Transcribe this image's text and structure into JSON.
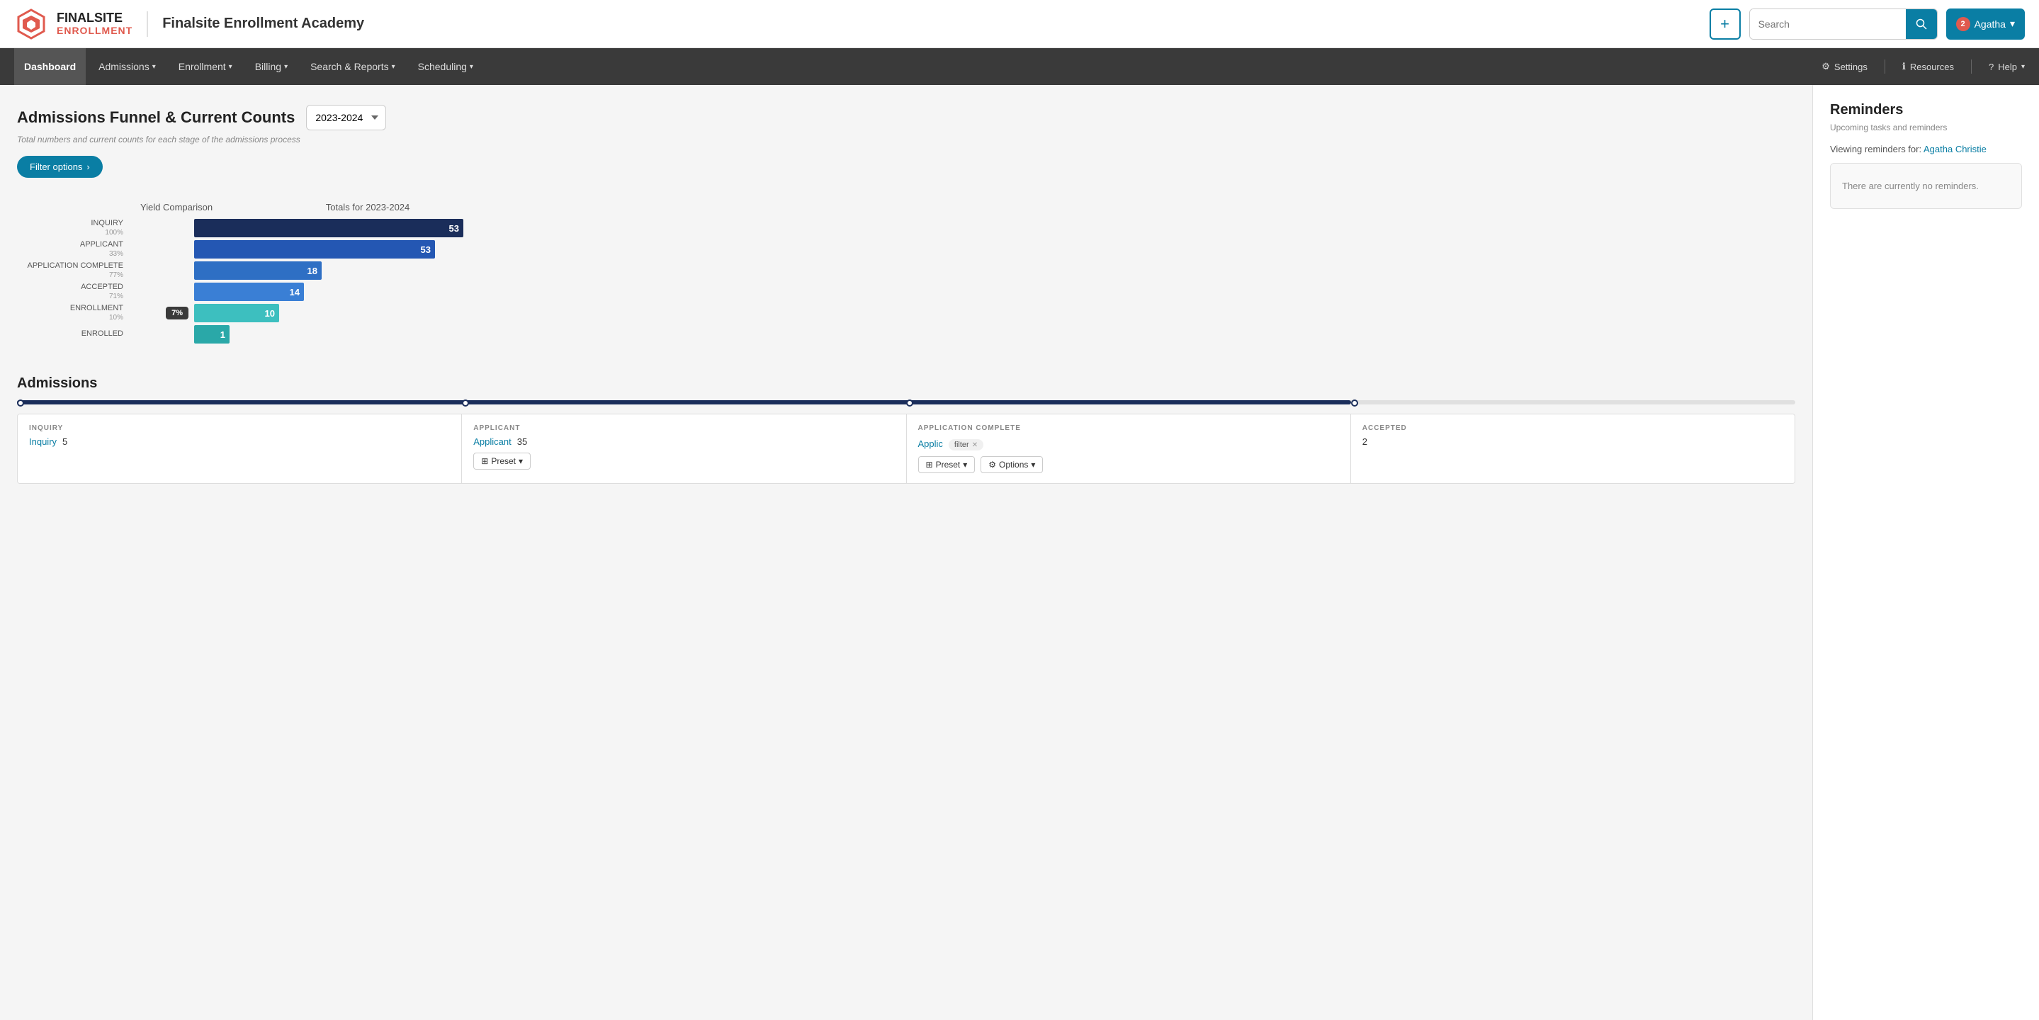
{
  "topBar": {
    "appTitle": "Finalsite Enrollment Academy",
    "logoLine1": "FINALSITE",
    "logoLine2": "ENROLLMENT",
    "addButtonLabel": "+",
    "searchPlaceholder": "Search",
    "searchLabel": "Search",
    "notifCount": "2",
    "userName": "Agatha",
    "chevron": "▾"
  },
  "nav": {
    "items": [
      {
        "label": "Dashboard",
        "active": true,
        "hasDropdown": false
      },
      {
        "label": "Admissions",
        "active": false,
        "hasDropdown": true
      },
      {
        "label": "Enrollment",
        "active": false,
        "hasDropdown": true
      },
      {
        "label": "Billing",
        "active": false,
        "hasDropdown": true
      },
      {
        "label": "Search & Reports",
        "active": false,
        "hasDropdown": true
      },
      {
        "label": "Scheduling",
        "active": false,
        "hasDropdown": true
      }
    ],
    "rightItems": [
      {
        "label": "Settings",
        "icon": "gear"
      },
      {
        "label": "Resources",
        "icon": "info"
      },
      {
        "label": "Help",
        "icon": "help",
        "hasDropdown": true
      }
    ]
  },
  "funnel": {
    "title": "Admissions Funnel & Current Counts",
    "subtitle": "Total numbers and current counts for each stage of the admissions process",
    "yearLabel": "2023-2024",
    "filterBtn": "Filter options",
    "chartYieldLabel": "Yield Comparison",
    "chartTotalsLabel": "Totals for 2023-2024",
    "rows": [
      {
        "label": "INQUIRY",
        "pct": "100%",
        "yieldBadge": null,
        "value": 53,
        "barWidth": 380,
        "barColor": "#1a2d5a"
      },
      {
        "label": "APPLICANT",
        "pct": "33%",
        "yieldBadge": null,
        "value": 53,
        "barWidth": 340,
        "barColor": "#2457b3"
      },
      {
        "label": "APPLICATION COMPLETE",
        "pct": "77%",
        "yieldBadge": null,
        "value": 18,
        "barWidth": 160,
        "barColor": "#2e6fc4"
      },
      {
        "label": "ACCEPTED",
        "pct": "71%",
        "yieldBadge": null,
        "value": 14,
        "barWidth": 140,
        "barColor": "#3a7fd5"
      },
      {
        "label": "ENROLLMENT",
        "pct": "10%",
        "yieldBadge": "7%",
        "value": 10,
        "barWidth": 110,
        "barColor": "#3dbfbf"
      },
      {
        "label": "ENROLLED",
        "pct": null,
        "yieldBadge": null,
        "value": 1,
        "barWidth": 50,
        "barColor": "#2aa8a8"
      }
    ]
  },
  "admissions": {
    "title": "Admissions",
    "stages": [
      {
        "stage": "INQUIRY",
        "linkLabel": "Inquiry",
        "count": 5,
        "tag": null,
        "hasPreset": false
      },
      {
        "stage": "APPLICANT",
        "linkLabel": "Applicant",
        "count": 35,
        "tag": null,
        "hasPreset": true
      },
      {
        "stage": "APPLICATION COMPLETE",
        "linkLabel": "Applic",
        "count": null,
        "tag": "filter",
        "hasPreset": true
      },
      {
        "stage": "ACCEPTED",
        "linkLabel": "",
        "count": 2,
        "tag": null,
        "hasPreset": false
      }
    ],
    "presetLabel": "Preset",
    "optionsLabel": "Options"
  },
  "reminders": {
    "title": "Reminders",
    "subtitle": "Upcoming tasks and reminders",
    "viewingText": "Viewing reminders for:",
    "viewingName": "Agatha Christie",
    "emptyText": "There are currently no reminders."
  }
}
